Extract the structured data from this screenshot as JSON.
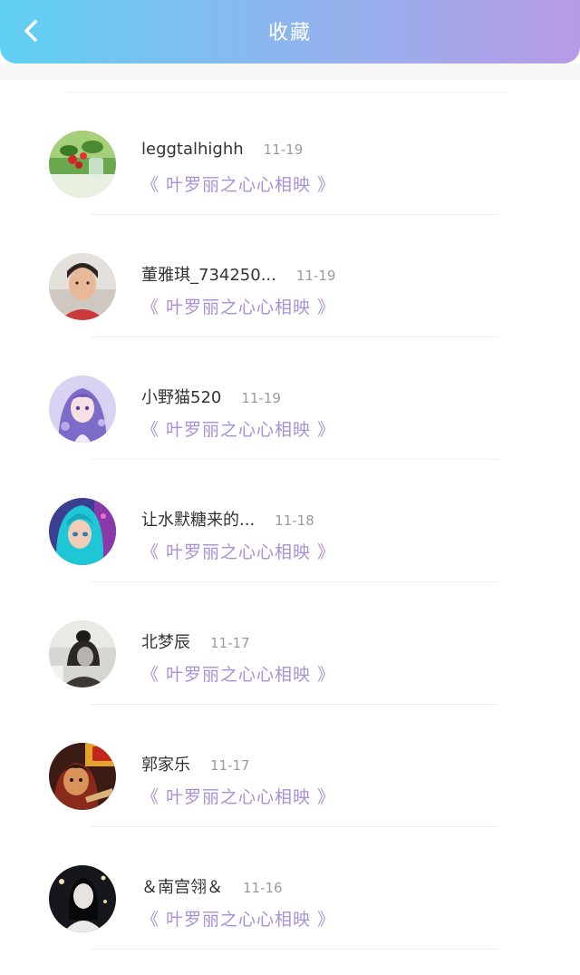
{
  "header": {
    "title": "收藏",
    "back_icon": "chevron-left-icon",
    "gradient_start": "#5fd0f2",
    "gradient_end": "#b79ae8"
  },
  "favorites": [
    {
      "name": "leggtalhighh",
      "date": "11-19",
      "work": "《 叶罗丽之心心相映 》",
      "avatar": "strawberry-plant-avatar"
    },
    {
      "name": "董雅琪_734250...",
      "date": "11-19",
      "work": "《 叶罗丽之心心相映 》",
      "avatar": "girl-photo-avatar"
    },
    {
      "name": "小野猫520",
      "date": "11-19",
      "work": "《 叶罗丽之心心相映 》",
      "avatar": "anime-girl-avatar"
    },
    {
      "name": "让水默糖来的...",
      "date": "11-18",
      "work": "《 叶罗丽之心心相映 》",
      "avatar": "blue-hair-doll-avatar"
    },
    {
      "name": "北梦辰",
      "date": "11-17",
      "work": "《 叶罗丽之心心相映 》",
      "avatar": "bw-girl-avatar"
    },
    {
      "name": "郭家乐",
      "date": "11-17",
      "work": "《 叶罗丽之心心相映 》",
      "avatar": "game-hero-avatar"
    },
    {
      "name": "＆南宫翎＆",
      "date": "11-16",
      "work": "《 叶罗丽之心心相映 》",
      "avatar": "dark-portrait-avatar"
    }
  ],
  "colors": {
    "name": "#333333",
    "date": "#9b9b9b",
    "work": "#a98fd9"
  }
}
